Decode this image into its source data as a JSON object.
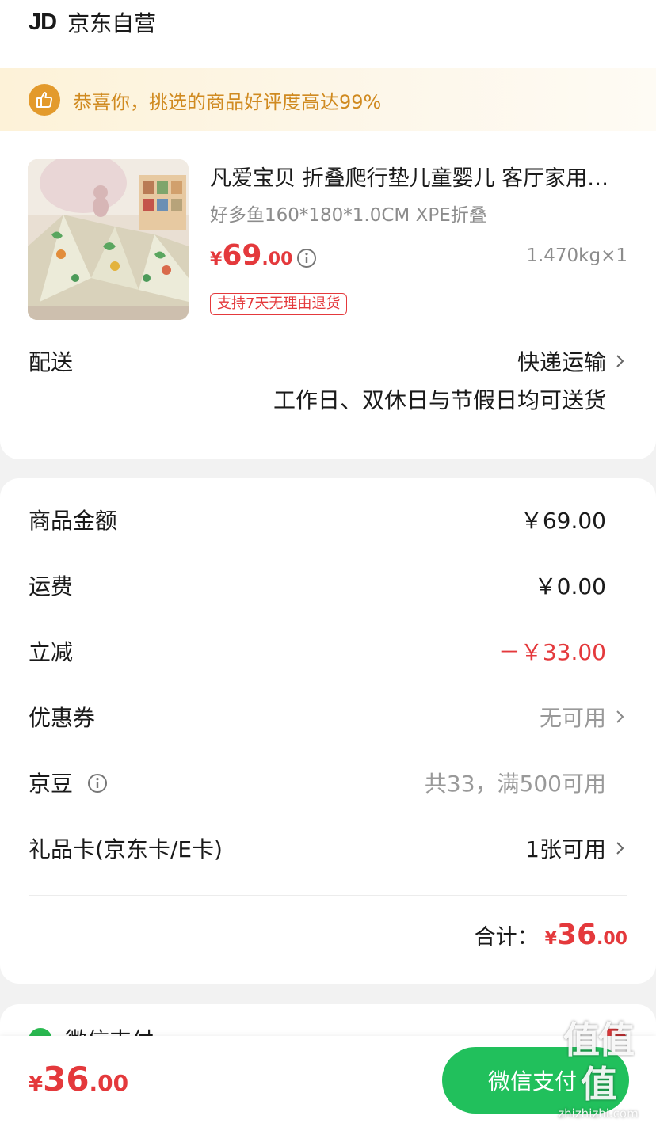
{
  "store": {
    "logo": "JD",
    "name": "京东自营"
  },
  "banner": {
    "icon": "thumbs-up-icon",
    "text": "恭喜你，挑选的商品好评度高达99%",
    "color": "#d08a20"
  },
  "product": {
    "title": "凡爱宝贝 折叠爬行垫儿童婴儿 客厅家用XPE",
    "spec": "好多鱼160*180*1.0CM XPE折叠",
    "price_symbol": "¥",
    "price_int": "69",
    "price_dec": ".00",
    "weight": "1.470kg×1",
    "return_tag": "支持7天无理由退货"
  },
  "delivery": {
    "label": "配送",
    "method": "快递运输",
    "note": "工作日、双休日与节假日均可送货"
  },
  "summary": {
    "rows": [
      {
        "label": "商品金额",
        "value": "￥69.00"
      },
      {
        "label": "运费",
        "value": "￥0.00"
      },
      {
        "label": "立减",
        "value": "－￥33.00"
      },
      {
        "label": "优惠券",
        "value": "无可用"
      },
      {
        "label": "京豆",
        "value": "共33，满500可用"
      },
      {
        "label": "礼品卡(京东卡/E卡)",
        "value": "1张可用"
      }
    ],
    "total_label": "合计：",
    "total_symbol": "¥",
    "total_int": "36",
    "total_dec": ".00"
  },
  "payment": {
    "method": "微信支付"
  },
  "bottom_bar": {
    "price_symbol": "¥",
    "price_int": "36",
    "price_dec": ".00",
    "pay_button": "微信支付"
  },
  "watermark": {
    "big": "值值值",
    "small": "zhizhizhi.com"
  },
  "colors": {
    "price_red": "#e4393c",
    "wechat_green": "#21c05c",
    "banner_orange": "#d08a20"
  }
}
